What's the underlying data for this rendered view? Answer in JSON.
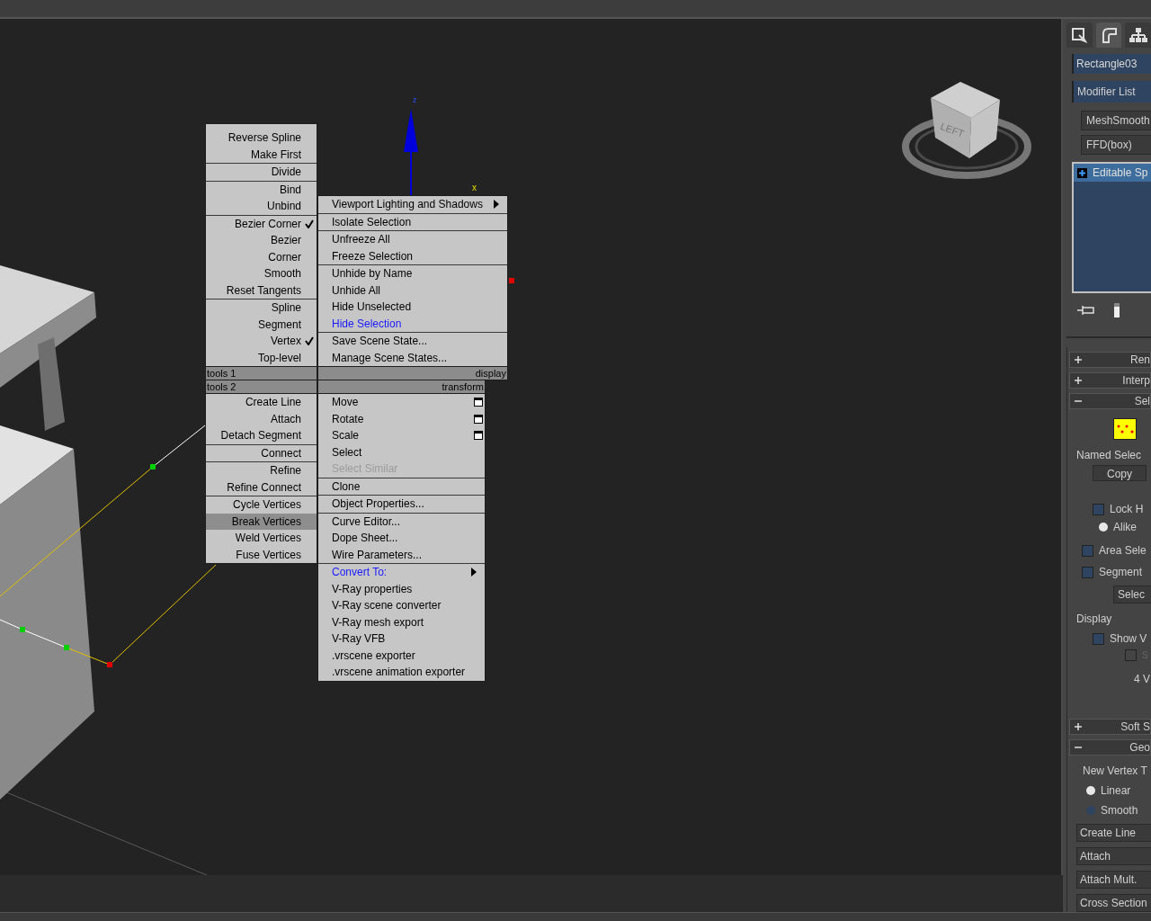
{
  "viewport": {
    "axis_labels": [
      "z",
      "x"
    ],
    "viewcube_label": "LEFT"
  },
  "quad_menu": {
    "upper_left": {
      "title": "tools 1",
      "groups": [
        [
          {
            "label": "Reverse Spline",
            "checked": false
          },
          {
            "label": "Make First",
            "checked": false
          }
        ],
        [
          {
            "label": "Divide",
            "checked": false
          }
        ],
        [
          {
            "label": "Bind",
            "checked": false
          },
          {
            "label": "Unbind",
            "checked": false
          }
        ],
        [
          {
            "label": "Bezier Corner",
            "checked": true
          },
          {
            "label": "Bezier",
            "checked": false
          },
          {
            "label": "Corner",
            "checked": false
          },
          {
            "label": "Smooth",
            "checked": false
          },
          {
            "label": "Reset Tangents",
            "checked": false
          }
        ],
        [
          {
            "label": "Spline",
            "checked": false
          },
          {
            "label": "Segment",
            "checked": false
          },
          {
            "label": "Vertex",
            "checked": true
          },
          {
            "label": "Top-level",
            "checked": false
          }
        ]
      ]
    },
    "lower_left": {
      "title": "tools 2",
      "groups": [
        [
          {
            "label": "Create Line",
            "selected": false
          },
          {
            "label": "Attach",
            "selected": false
          },
          {
            "label": "Detach Segment",
            "selected": false
          }
        ],
        [
          {
            "label": "Connect",
            "selected": false
          }
        ],
        [
          {
            "label": "Refine",
            "selected": false
          },
          {
            "label": "Refine Connect",
            "selected": false
          }
        ],
        [
          {
            "label": "Cycle Vertices",
            "selected": false
          },
          {
            "label": "Break Vertices",
            "selected": true
          },
          {
            "label": "Weld Vertices",
            "selected": false
          },
          {
            "label": "Fuse Vertices",
            "selected": false
          }
        ]
      ]
    },
    "upper_right": {
      "title": "display",
      "groups": [
        [
          {
            "label": "Viewport Lighting and Shadows",
            "last_used": false,
            "submenu": true
          }
        ],
        [
          {
            "label": "Isolate Selection",
            "last_used": false,
            "submenu": false
          }
        ],
        [
          {
            "label": "Unfreeze All",
            "last_used": false,
            "submenu": false
          },
          {
            "label": "Freeze Selection",
            "last_used": false,
            "submenu": false
          }
        ],
        [
          {
            "label": "Unhide by Name",
            "last_used": false,
            "submenu": false
          },
          {
            "label": "Unhide All",
            "last_used": false,
            "submenu": false
          },
          {
            "label": "Hide Unselected",
            "last_used": false,
            "submenu": false
          },
          {
            "label": "Hide Selection",
            "last_used": true,
            "submenu": false
          }
        ],
        [
          {
            "label": "Save Scene State...",
            "last_used": false,
            "submenu": false
          },
          {
            "label": "Manage Scene States...",
            "last_used": false,
            "submenu": false
          }
        ]
      ]
    },
    "lower_right": {
      "title": "transform",
      "groups": [
        [
          {
            "label": "Move",
            "option_box": true,
            "disabled": false,
            "last_used": false,
            "submenu": false
          },
          {
            "label": "Rotate",
            "option_box": true,
            "disabled": false,
            "last_used": false,
            "submenu": false
          },
          {
            "label": "Scale",
            "option_box": true,
            "disabled": false,
            "last_used": false,
            "submenu": false
          },
          {
            "label": "Select",
            "option_box": false,
            "disabled": false,
            "last_used": false,
            "submenu": false
          },
          {
            "label": "Select Similar",
            "option_box": false,
            "disabled": true,
            "last_used": false,
            "submenu": false
          }
        ],
        [
          {
            "label": "Clone",
            "option_box": false,
            "disabled": false,
            "last_used": false,
            "submenu": false
          }
        ],
        [
          {
            "label": "Object Properties...",
            "option_box": false,
            "disabled": false,
            "last_used": false,
            "submenu": false
          }
        ],
        [
          {
            "label": "Curve Editor...",
            "option_box": false,
            "disabled": false,
            "last_used": false,
            "submenu": false
          },
          {
            "label": "Dope Sheet...",
            "option_box": false,
            "disabled": false,
            "last_used": false,
            "submenu": false
          },
          {
            "label": "Wire Parameters...",
            "option_box": false,
            "disabled": false,
            "last_used": false,
            "submenu": false
          }
        ],
        [
          {
            "label": "Convert To:",
            "option_box": false,
            "disabled": false,
            "last_used": true,
            "submenu": true
          },
          {
            "label": "V-Ray properties",
            "option_box": false,
            "disabled": false,
            "last_used": false,
            "submenu": false
          },
          {
            "label": "V-Ray scene converter",
            "option_box": false,
            "disabled": false,
            "last_used": false,
            "submenu": false
          },
          {
            "label": "V-Ray mesh export",
            "option_box": false,
            "disabled": false,
            "last_used": false,
            "submenu": false
          },
          {
            "label": "V-Ray VFB",
            "option_box": false,
            "disabled": false,
            "last_used": false,
            "submenu": false
          },
          {
            "label": ".vrscene exporter",
            "option_box": false,
            "disabled": false,
            "last_used": false,
            "submenu": false
          },
          {
            "label": ".vrscene animation exporter",
            "option_box": false,
            "disabled": false,
            "last_used": false,
            "submenu": false
          }
        ]
      ]
    }
  },
  "command_panel": {
    "tabs": [
      {
        "kind": "create",
        "selected": false
      },
      {
        "kind": "modify",
        "selected": true
      },
      {
        "kind": "hierarchy",
        "selected": false
      }
    ],
    "object_name": "Rectangle03",
    "modifier_list": "Modifier List",
    "modifier_buttons": [
      "MeshSmooth",
      "FFD(box)"
    ],
    "stack": [
      {
        "label": "Editable Sp",
        "selected": true,
        "expanded": false
      }
    ],
    "rollouts_top": [
      {
        "label": "Ren",
        "expanded": false
      },
      {
        "label": "Interp",
        "expanded": false
      },
      {
        "label": "Sel",
        "expanded": true
      }
    ],
    "selection": {
      "named_selections": "Named Selec",
      "copy_button": "Copy",
      "lock": {
        "label": "Lock H",
        "checked": false
      },
      "alike": {
        "label": "Alike",
        "selected": true
      },
      "area": {
        "label": "Area Sele",
        "checked": false
      },
      "segment": {
        "label": "Segment",
        "checked": false
      },
      "select_button": "Selec",
      "display_title": "Display",
      "show": {
        "label": "Show V",
        "checked": false
      },
      "sub_option": {
        "label": "S",
        "checked": false,
        "disabled": true
      },
      "summary": "4 V"
    },
    "rollouts_bottom": [
      {
        "label": "Soft S",
        "expanded": false
      },
      {
        "label": "Geo",
        "expanded": true
      }
    ],
    "geometry": {
      "new_vertex_title": "New Vertex T",
      "radios": [
        {
          "label": "Linear",
          "selected": true
        },
        {
          "label": "Smooth",
          "selected": false
        }
      ],
      "buttons": [
        "Create Line",
        "Attach",
        "Attach Mult.",
        "Cross Section"
      ]
    }
  }
}
